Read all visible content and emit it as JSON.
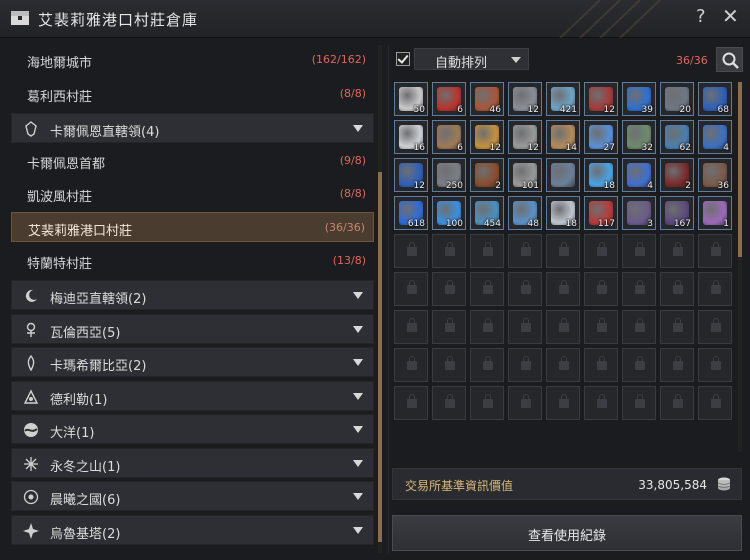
{
  "window": {
    "title": "艾裴莉雅港口村莊倉庫",
    "help_label": "?",
    "close_label": "✕"
  },
  "towns_top": [
    {
      "name": "海地爾城市",
      "count": "(162/162)"
    },
    {
      "name": "葛利西村莊",
      "count": "(8/8)"
    }
  ],
  "regions": [
    {
      "name": "卡爾佩恩直轄領(4)",
      "icon": "crest-icon"
    },
    {
      "name": "梅迪亞直轄領(2)",
      "icon": "moon-icon"
    },
    {
      "name": "瓦倫西亞(5)",
      "icon": "ankh-icon"
    },
    {
      "name": "卡瑪希爾比亞(2)",
      "icon": "flame-icon"
    },
    {
      "name": "德利勒(1)",
      "icon": "lotus-icon"
    },
    {
      "name": "大洋(1)",
      "icon": "wave-icon"
    },
    {
      "name": "永冬之山(1)",
      "icon": "snow-icon"
    },
    {
      "name": "晨曦之國(6)",
      "icon": "flower-icon"
    },
    {
      "name": "烏魯基塔(2)",
      "icon": "star-icon"
    }
  ],
  "towns_calpheon": [
    {
      "name": "卡爾佩恩首都",
      "count": "(9/8)"
    },
    {
      "name": "凱波風村莊",
      "count": "(8/8)"
    },
    {
      "name": "艾裴莉雅港口村莊",
      "count": "(36/36)",
      "selected": true
    },
    {
      "name": "特蘭特村莊",
      "count": "(13/8)"
    }
  ],
  "toolbar": {
    "auto_sort_label": "自動排列",
    "auto_sort_checked": true,
    "capacity": "36/36"
  },
  "items": [
    {
      "qty": "50",
      "color": "#c9c9c9"
    },
    {
      "qty": "6",
      "color": "#b8332d"
    },
    {
      "qty": "46",
      "color": "#a8563a"
    },
    {
      "qty": "12",
      "color": "#8a8f96"
    },
    {
      "qty": "421",
      "color": "#6ea3c8"
    },
    {
      "qty": "12",
      "color": "#a23a3a"
    },
    {
      "qty": "39",
      "color": "#2f6fcf"
    },
    {
      "qty": "20",
      "color": "#6e7784"
    },
    {
      "qty": "68",
      "color": "#2d5fb8"
    },
    {
      "qty": "16",
      "color": "#cfcfd6"
    },
    {
      "qty": "6",
      "color": "#9d7a56"
    },
    {
      "qty": "12",
      "color": "#c4913f"
    },
    {
      "qty": "12",
      "color": "#9a9a9a"
    },
    {
      "qty": "14",
      "color": "#b38b5a"
    },
    {
      "qty": "27",
      "color": "#5a8fd6"
    },
    {
      "qty": "32",
      "color": "#6e8a6e"
    },
    {
      "qty": "62",
      "color": "#4a7fb0"
    },
    {
      "qty": "4",
      "color": "#3c6fc0"
    },
    {
      "qty": "12",
      "color": "#2f5fb8"
    },
    {
      "qty": "250",
      "color": "#7a7e86"
    },
    {
      "qty": "2",
      "color": "#8a4c2e"
    },
    {
      "qty": "101",
      "color": "#9a9a9a"
    },
    {
      "qty": "",
      "color": "#6a7f9a"
    },
    {
      "qty": "18",
      "color": "#4aa2e6"
    },
    {
      "qty": "4",
      "color": "#3f6fd0"
    },
    {
      "qty": "2",
      "color": "#7a2a2a"
    },
    {
      "qty": "36",
      "color": "#7a5a4a"
    },
    {
      "qty": "618",
      "color": "#2f6ad6"
    },
    {
      "qty": "100",
      "color": "#3a8fe0"
    },
    {
      "qty": "454",
      "color": "#4a90c0"
    },
    {
      "qty": "48",
      "color": "#5a90c8"
    },
    {
      "qty": "18",
      "color": "#bfc6cf"
    },
    {
      "qty": "117",
      "color": "#b83a3a"
    },
    {
      "qty": "3",
      "color": "#6a5a8a"
    },
    {
      "qty": "167",
      "color": "#5a4a7a"
    },
    {
      "qty": "1",
      "color": "#9a6ab8"
    }
  ],
  "locked_slots": 45,
  "trade_value": {
    "label": "交易所基準資訊價值",
    "value": "33,805,584"
  },
  "history_button": "查看使用紀錄"
}
